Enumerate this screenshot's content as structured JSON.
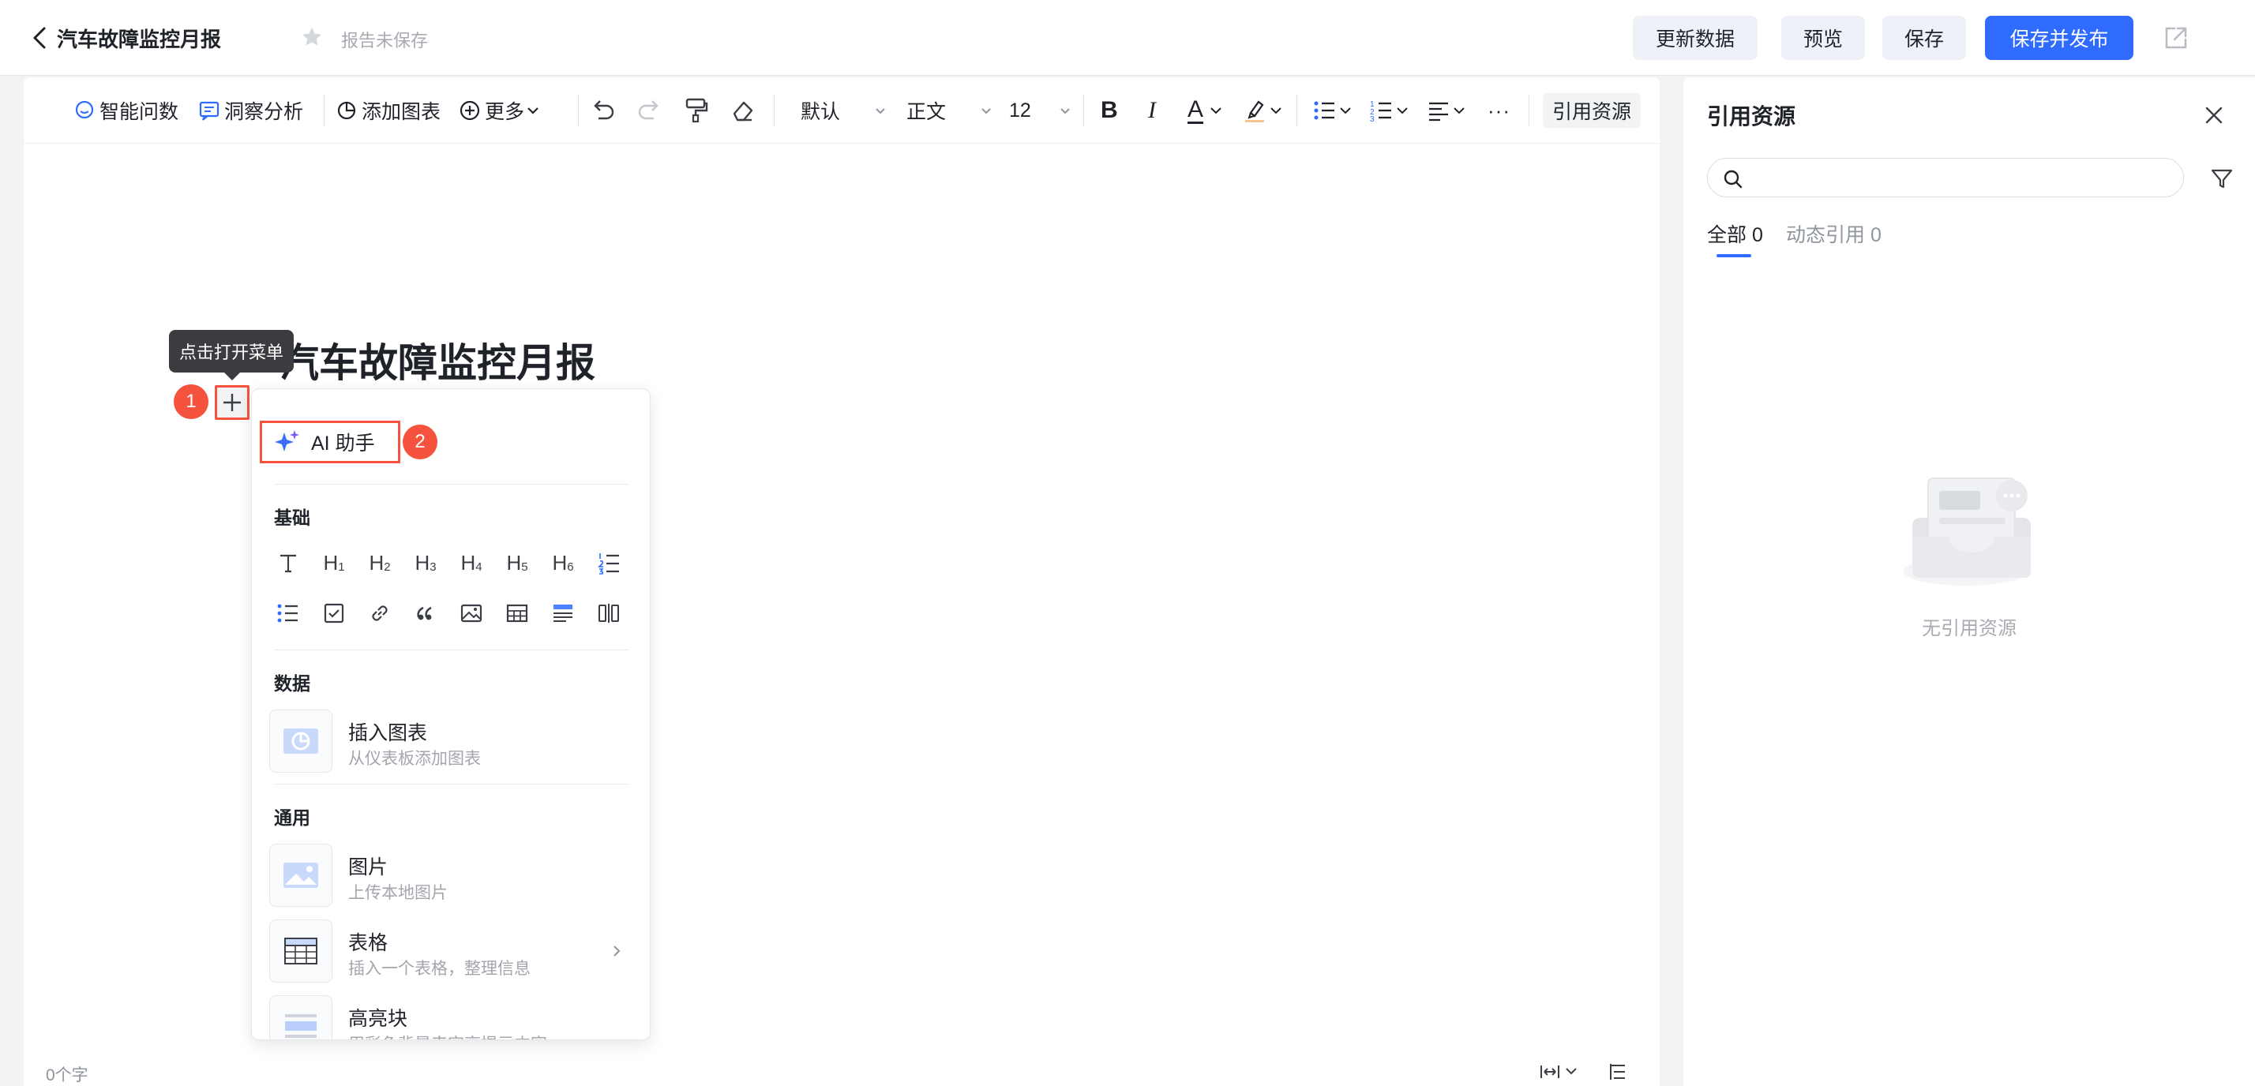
{
  "header": {
    "title": "汽车故障监控月报",
    "save_status": "报告未保存",
    "buttons": {
      "update": "更新数据",
      "preview": "预览",
      "save": "保存",
      "save_publish": "保存并发布"
    },
    "colors": {
      "primary": "#2f6bff",
      "secondary_bg": "#eef1f7"
    }
  },
  "toolbar": {
    "smart_query": "智能问数",
    "insight": "洞察分析",
    "add_chart": "添加图表",
    "more": "更多",
    "style": "默认",
    "paragraph": "正文",
    "font_size": "12",
    "bold": "B",
    "italic": "I",
    "font_color": "A",
    "overflow": "···",
    "cite_resources": "引用资源"
  },
  "document": {
    "title": "汽车故障监控月报",
    "word_count": "0个字"
  },
  "tooltip": "点击打开菜单",
  "annotations": {
    "step1": "1",
    "step2": "2",
    "color": "#f5533d"
  },
  "insert_menu": {
    "ai_assistant": "AI 助手",
    "section_basic": "基础",
    "basic_row1": [
      {
        "icon": "text-icon",
        "glyph": "T",
        "sub": ""
      },
      {
        "icon": "heading1-icon",
        "glyph": "H",
        "sub": "1"
      },
      {
        "icon": "heading2-icon",
        "glyph": "H",
        "sub": "2"
      },
      {
        "icon": "heading3-icon",
        "glyph": "H",
        "sub": "3"
      },
      {
        "icon": "heading4-icon",
        "glyph": "H",
        "sub": "4"
      },
      {
        "icon": "heading5-icon",
        "glyph": "H",
        "sub": "5"
      },
      {
        "icon": "heading6-icon",
        "glyph": "H",
        "sub": "6"
      },
      {
        "icon": "ordered-list-icon",
        "glyph": "",
        "sub": ""
      }
    ],
    "basic_row2": [
      {
        "icon": "bullet-list-icon"
      },
      {
        "icon": "checkbox-icon"
      },
      {
        "icon": "link-icon"
      },
      {
        "icon": "quote-icon"
      },
      {
        "icon": "image-icon"
      },
      {
        "icon": "table-icon"
      },
      {
        "icon": "highlight-block-icon"
      },
      {
        "icon": "columns-icon"
      }
    ],
    "section_data": "数据",
    "insert_chart": {
      "title": "插入图表",
      "desc": "从仪表板添加图表"
    },
    "section_general": "通用",
    "picture": {
      "title": "图片",
      "desc": "上传本地图片"
    },
    "table": {
      "title": "表格",
      "desc": "插入一个表格，整理信息"
    },
    "highlight": {
      "title": "高亮块",
      "desc": "用彩色背景来突亮提示内容"
    }
  },
  "panel": {
    "title": "引用资源",
    "search_placeholder": "",
    "tabs": [
      {
        "label": "全部 0",
        "active": true
      },
      {
        "label": "动态引用 0",
        "active": false
      }
    ],
    "empty_text": "无引用资源"
  }
}
